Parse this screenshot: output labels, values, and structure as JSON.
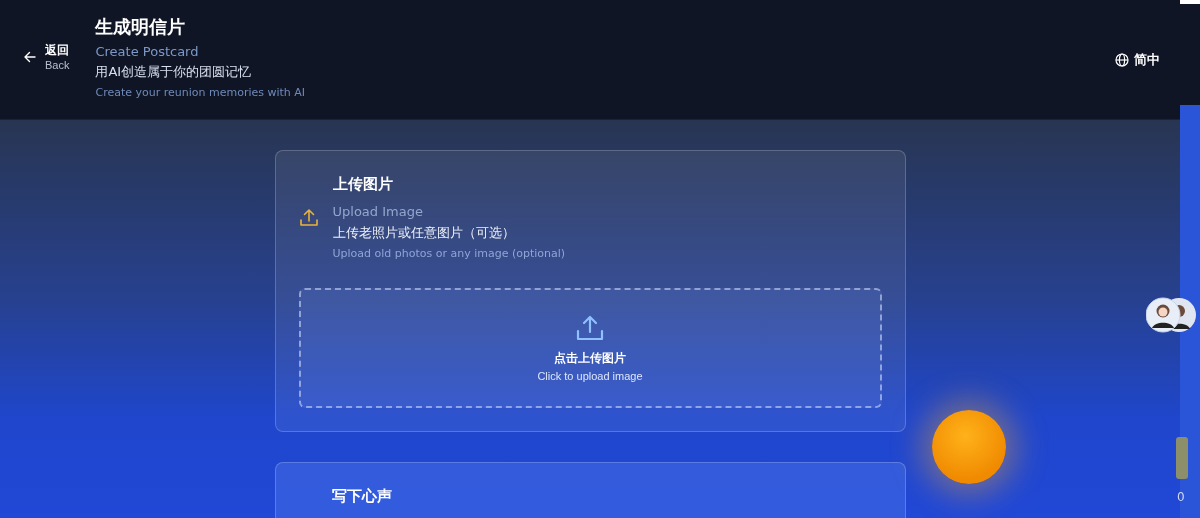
{
  "header": {
    "back": {
      "label_zh": "返回",
      "label_en": "Back"
    },
    "title_zh": "生成明信片",
    "title_en": "Create Postcard",
    "subtitle_zh": "用AI创造属于你的团圆记忆",
    "subtitle_en": "Create your reunion memories with AI",
    "language": "简中"
  },
  "sections": [
    {
      "kind": "upload",
      "title_zh": "上传图片",
      "title_en": "Upload Image",
      "desc_zh": "上传老照片或任意图片（可选）",
      "desc_en": "Upload old photos or any image (optional)",
      "dropzone_zh": "点击上传图片",
      "dropzone_en": "Click to upload image"
    },
    {
      "kind": "text",
      "title_zh": "写下心声"
    }
  ],
  "edge_text": "0"
}
